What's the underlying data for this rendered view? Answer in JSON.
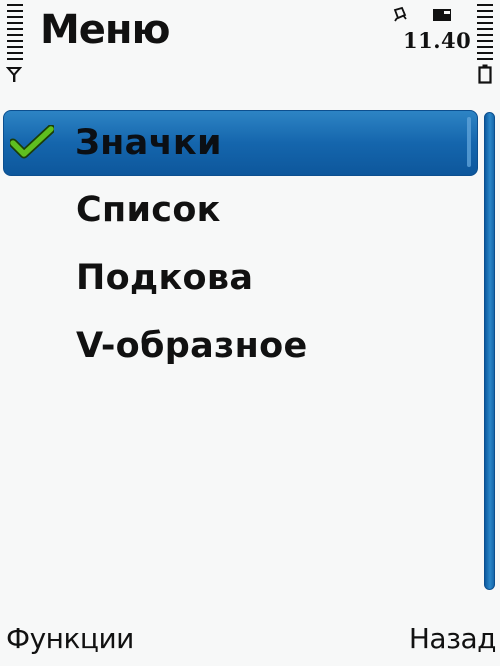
{
  "header": {
    "title": "Меню"
  },
  "status": {
    "time": "11.40",
    "icons": [
      "signal-strength-icon",
      "antenna-icon",
      "alarm-icon",
      "sim-card-icon",
      "battery-level-icon",
      "battery-icon"
    ]
  },
  "menu": {
    "items": [
      {
        "label": "Значки",
        "selected": true,
        "checked": true
      },
      {
        "label": "Список",
        "selected": false,
        "checked": false
      },
      {
        "label": "Подкова",
        "selected": false,
        "checked": false
      },
      {
        "label": "V-образное",
        "selected": false,
        "checked": false
      }
    ]
  },
  "softkeys": {
    "left": "Функции",
    "right": "Назад"
  },
  "colors": {
    "background": "#f7f8f8",
    "highlight": "#1566ad",
    "check": "#5fbf1f",
    "text": "#111111"
  }
}
